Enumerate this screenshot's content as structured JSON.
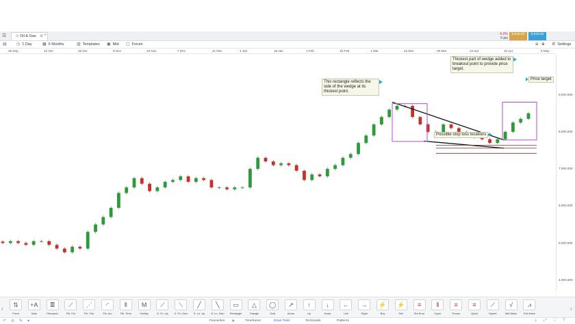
{
  "app": {
    "tab_title": "Oil & Gas",
    "tab_close": "⊗",
    "add_tab": "+",
    "menu_icon": "hamburger-icon"
  },
  "ticker": {
    "change_pct": "-6.0%",
    "change_pips": "0 pts",
    "sell_price": "8,542.83",
    "buy_price": "8,543.83",
    "colors": {
      "sell": "#d9a44a",
      "buy": "#3aa0d8"
    }
  },
  "toolbar": {
    "interval": "1 Day",
    "range": "6 Months",
    "templates": "Templates",
    "mid": "Mid",
    "forum": "Forum",
    "settings": "Settings"
  },
  "dates": [
    "28 Sep",
    "12 Oct",
    "26 Oct",
    "9 Nov",
    "23 Nov",
    "7 Dec",
    "21 Dec",
    "4 Jan",
    "18 Jan",
    "1 Feb",
    "15 Feb",
    "1 Mar",
    "15 Mar",
    "29 Mar",
    "12 Apr",
    "26 Apr",
    "8 May"
  ],
  "yaxis": [
    "9,000.000",
    "8,000.000",
    "7,000.000",
    "6,000.000",
    "5,000.000",
    "4,000.000"
  ],
  "annotations": {
    "rectangle_note": "This rectangle reflects the side of the wedge at its thickest point.",
    "wedge_note": "Thickest part of wedge added to breakout point to provide price target.",
    "price_target": "Price target",
    "stop_loss": "Possible stop loss locations"
  },
  "tools": [
    {
      "label": "Fixed",
      "icon": "fixed-line-icon",
      "glyph": "⇅"
    },
    {
      "label": "Note",
      "icon": "note-icon",
      "glyph": "+A"
    },
    {
      "label": "Fibonacci",
      "icon": "fibonacci-icon",
      "glyph": "≣"
    },
    {
      "label": "Fib. Ext",
      "icon": "fib-ext-icon",
      "glyph": "⟋"
    },
    {
      "label": "Fib. Fan",
      "icon": "fib-fan-icon",
      "glyph": "⋰"
    },
    {
      "label": "Fib. Arc",
      "icon": "fib-arc-icon",
      "glyph": "◜"
    },
    {
      "label": "Fib. Time",
      "icon": "fib-time-icon",
      "glyph": "⦀"
    },
    {
      "label": "Gartley",
      "icon": "gartley-icon",
      "glyph": "M"
    },
    {
      "label": "G. Fn. Up",
      "icon": "gann-fan-up-icon",
      "glyph": "⟋"
    },
    {
      "label": "G. Fn. Dwn",
      "icon": "gann-fan-down-icon",
      "glyph": "⟍"
    },
    {
      "label": "G. Ln. Up",
      "icon": "gann-line-up-icon",
      "glyph": "╱"
    },
    {
      "label": "G. Ln. Dwn",
      "icon": "gann-line-down-icon",
      "glyph": "╲"
    },
    {
      "label": "Rectangle",
      "icon": "rectangle-icon",
      "glyph": "▭"
    },
    {
      "label": "Triangle",
      "icon": "triangle-icon",
      "glyph": "△"
    },
    {
      "label": "Oval",
      "icon": "oval-icon",
      "glyph": "◯"
    },
    {
      "label": "Arrow",
      "icon": "arrow-icon",
      "glyph": "↗"
    },
    {
      "label": "Up",
      "icon": "up-arrow-icon",
      "glyph": "↑"
    },
    {
      "label": "Down",
      "icon": "down-arrow-icon",
      "glyph": "↓"
    },
    {
      "label": "Left",
      "icon": "left-arrow-icon",
      "glyph": "←"
    },
    {
      "label": "Right",
      "icon": "right-arrow-icon",
      "glyph": "→"
    },
    {
      "label": "Buy",
      "icon": "buy-icon",
      "glyph": "⚡"
    },
    {
      "label": "Sell",
      "icon": "sell-icon",
      "glyph": "⚡"
    },
    {
      "label": "Std Error",
      "icon": "std-error-icon",
      "glyph": "≡"
    },
    {
      "label": "Cycle",
      "icon": "cycle-icon",
      "glyph": "⫴"
    },
    {
      "label": "Throne",
      "icon": "throne-icon",
      "glyph": "≡"
    },
    {
      "label": "Quad",
      "icon": "quad-icon",
      "glyph": "≡"
    },
    {
      "label": "Speed",
      "icon": "speed-icon",
      "glyph": "⟋"
    },
    {
      "label": "Mid Wave",
      "icon": "mid-wave-icon",
      "glyph": "√"
    },
    {
      "label": "Full Wave",
      "icon": "full-wave-icon",
      "glyph": "⩘"
    }
  ],
  "bottom_tabs": [
    "Favourites",
    "Timeframe",
    "Draw Tools",
    "Technicals",
    "Patterns"
  ],
  "active_bottom_tab": "Draw Tools",
  "chart_data": {
    "type": "candlestick",
    "colors": {
      "up": "#2e9b3a",
      "down": "#c9302c"
    },
    "ylim": [
      3700,
      10100
    ],
    "x": [
      "28 Sep",
      "12 Oct",
      "26 Oct",
      "9 Nov",
      "23 Nov",
      "7 Dec",
      "21 Dec",
      "4 Jan",
      "18 Jan",
      "1 Feb",
      "15 Feb",
      "1 Mar",
      "15 Mar",
      "29 Mar",
      "12 Apr",
      "26 Apr",
      "8 May"
    ],
    "closes_approx": [
      5000,
      5050,
      5000,
      4950,
      5050,
      5050,
      4950,
      4850,
      4750,
      4900,
      4850,
      5300,
      5500,
      5700,
      5950,
      6350,
      6500,
      6750,
      6600,
      6400,
      6500,
      6650,
      6700,
      6800,
      6650,
      6750,
      6700,
      6500,
      6500,
      6450,
      6500,
      6500,
      7000,
      7300,
      7200,
      7100,
      7150,
      7100,
      6950,
      6700,
      6850,
      6800,
      7000,
      7100,
      7300,
      7400,
      7700,
      7900,
      8200,
      8400,
      8600,
      8700,
      8700,
      8400,
      8200,
      8000,
      7950,
      8200,
      8100,
      8000,
      7900,
      7850,
      7800,
      7700,
      7800,
      8000,
      8250,
      8350,
      8500
    ]
  }
}
